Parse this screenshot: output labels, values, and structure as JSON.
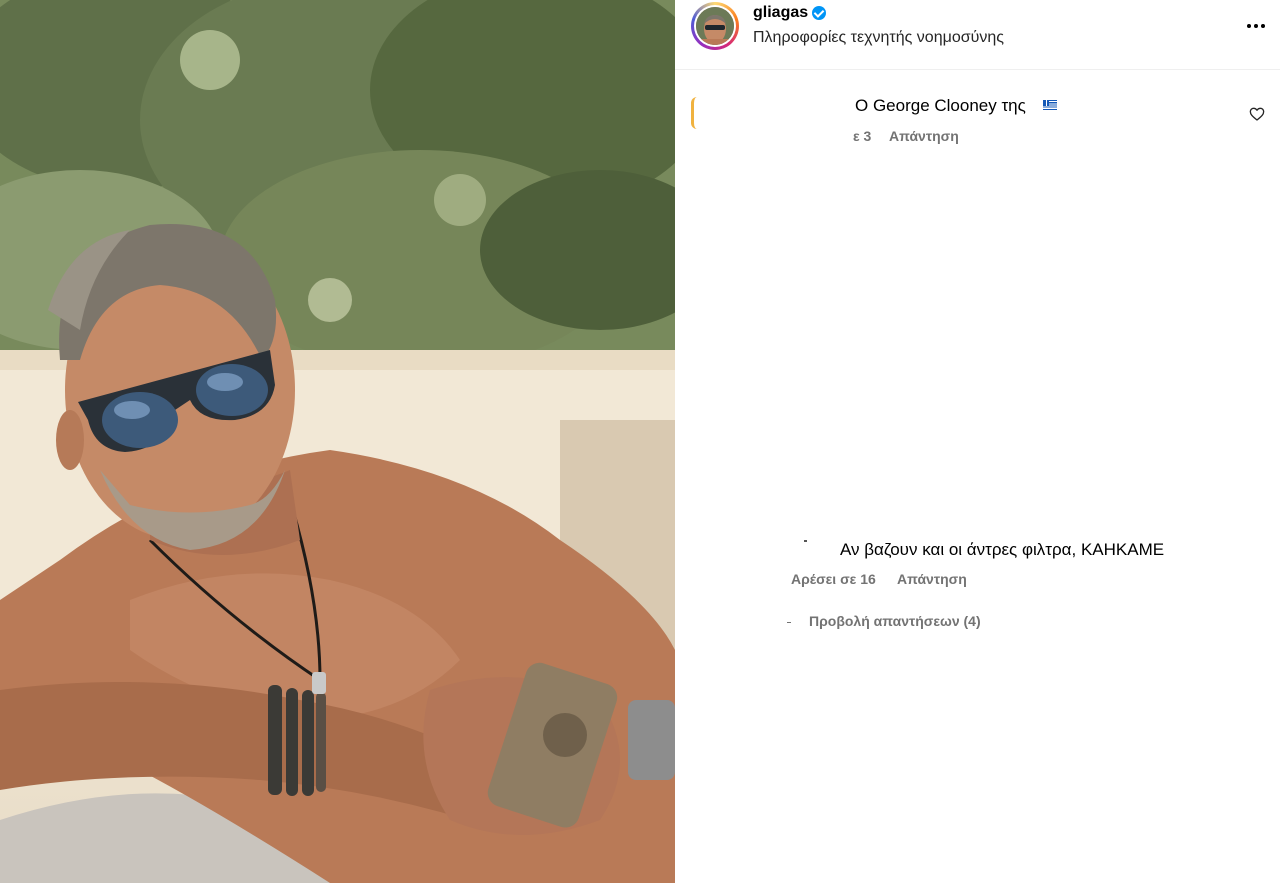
{
  "post": {
    "photo_icon": "post-photo",
    "author": {
      "username": "gliagas",
      "verified": true,
      "subtitle": "Πληροφορίες τεχνητής νοημοσύνης"
    },
    "more_icon": "more-horizontal-icon"
  },
  "comments": [
    {
      "text": "Ο George Clooney της",
      "emoji": "greek-flag",
      "meta_fragment": "ε 3",
      "reply_label": "Απάντηση",
      "like_icon": "heart-outline-icon"
    },
    {
      "text": "Αν βαζουν και οι άντρες φιλτρα, ΚΑΗΚΑΜΕ",
      "likes_label": "Αρέσει σε 16",
      "reply_label": "Απάντηση",
      "view_replies_label": "Προβολή απαντήσεων (4)"
    }
  ],
  "colors": {
    "secondary_text": "#737373",
    "verified_blue": "#0095f6",
    "divider": "#efefef"
  }
}
